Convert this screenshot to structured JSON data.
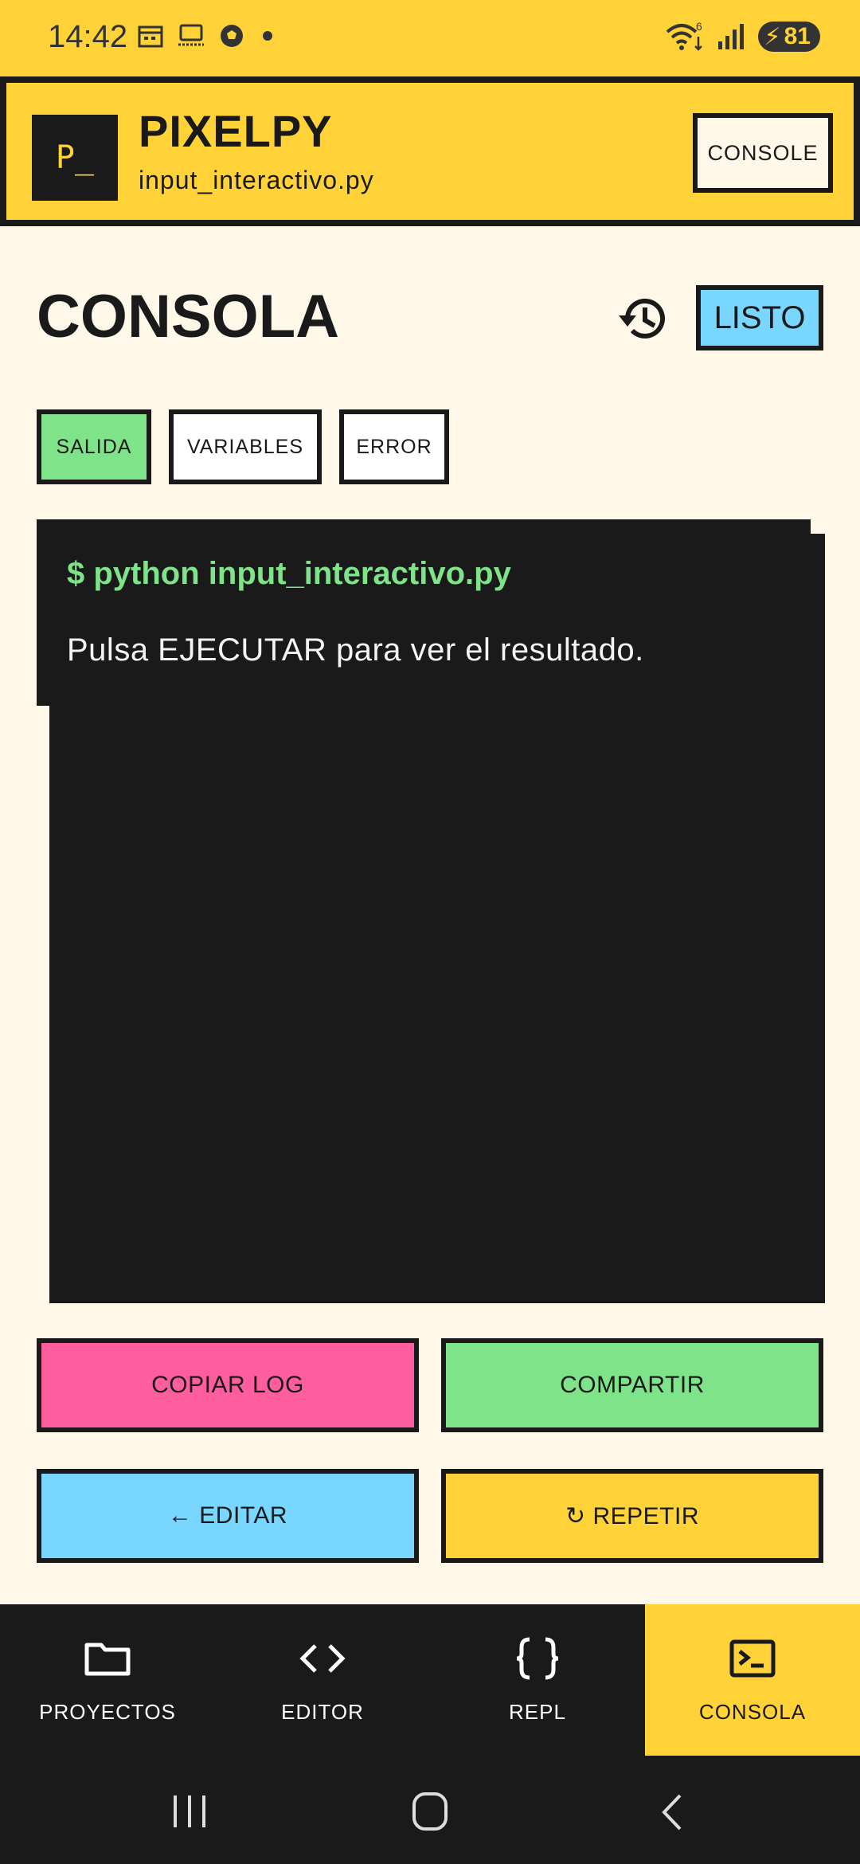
{
  "status_bar": {
    "time": "14:42",
    "battery": "81",
    "wifi_badge": "6"
  },
  "app": {
    "logo_text": "P_",
    "title": "PIXELPY",
    "filename": "input_interactivo.py",
    "console_button": "CONSOLE"
  },
  "page": {
    "title": "CONSOLA",
    "status_badge": "LISTO"
  },
  "tabs": [
    {
      "label": "SALIDA",
      "active": true
    },
    {
      "label": "VARIABLES",
      "active": false
    },
    {
      "label": "ERROR",
      "active": false
    }
  ],
  "console": {
    "command": "$ python input_interactivo.py",
    "output": "Pulsa EJECUTAR para ver el resultado."
  },
  "actions": {
    "copy_log": "COPIAR LOG",
    "share": "COMPARTIR",
    "edit": "← EDITAR",
    "repeat": "↻ REPETIR"
  },
  "nav": [
    {
      "label": "PROYECTOS",
      "icon": "folder-icon",
      "active": false
    },
    {
      "label": "EDITOR",
      "icon": "code-icon",
      "active": false
    },
    {
      "label": "REPL",
      "icon": "braces-icon",
      "active": false
    },
    {
      "label": "CONSOLA",
      "icon": "terminal-icon",
      "active": true
    }
  ],
  "colors": {
    "accent_yellow": "#FFD338",
    "background": "#FFF8E8",
    "ink": "#1A1A1A",
    "green": "#7FE38A",
    "blue": "#79D6FF",
    "pink": "#FF5E9E"
  }
}
